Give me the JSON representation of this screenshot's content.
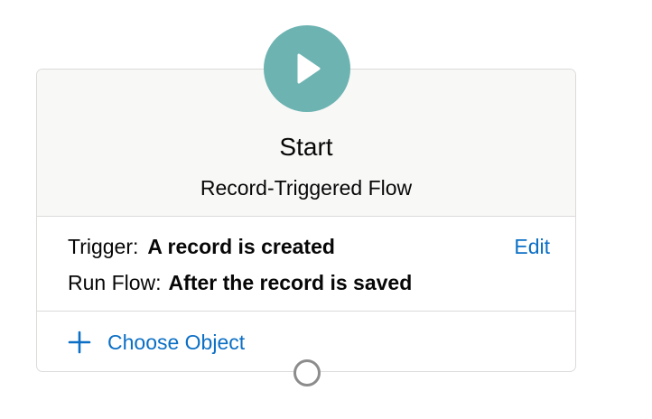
{
  "node": {
    "title": "Start",
    "subtitle": "Record-Triggered Flow",
    "icon": "play-icon",
    "accent_color": "#6cb3b2"
  },
  "details": {
    "trigger_label": "Trigger:",
    "trigger_value": "A record is created",
    "run_label": "Run Flow:",
    "run_value": "After the record is saved",
    "edit_label": "Edit"
  },
  "object": {
    "choose_label": "Choose Object",
    "icon": "plus-icon"
  },
  "connector": {
    "icon": "connector-circle-icon"
  },
  "colors": {
    "link": "#0b6fc5",
    "border": "#dddbda",
    "header_bg": "#f8f8f7"
  }
}
